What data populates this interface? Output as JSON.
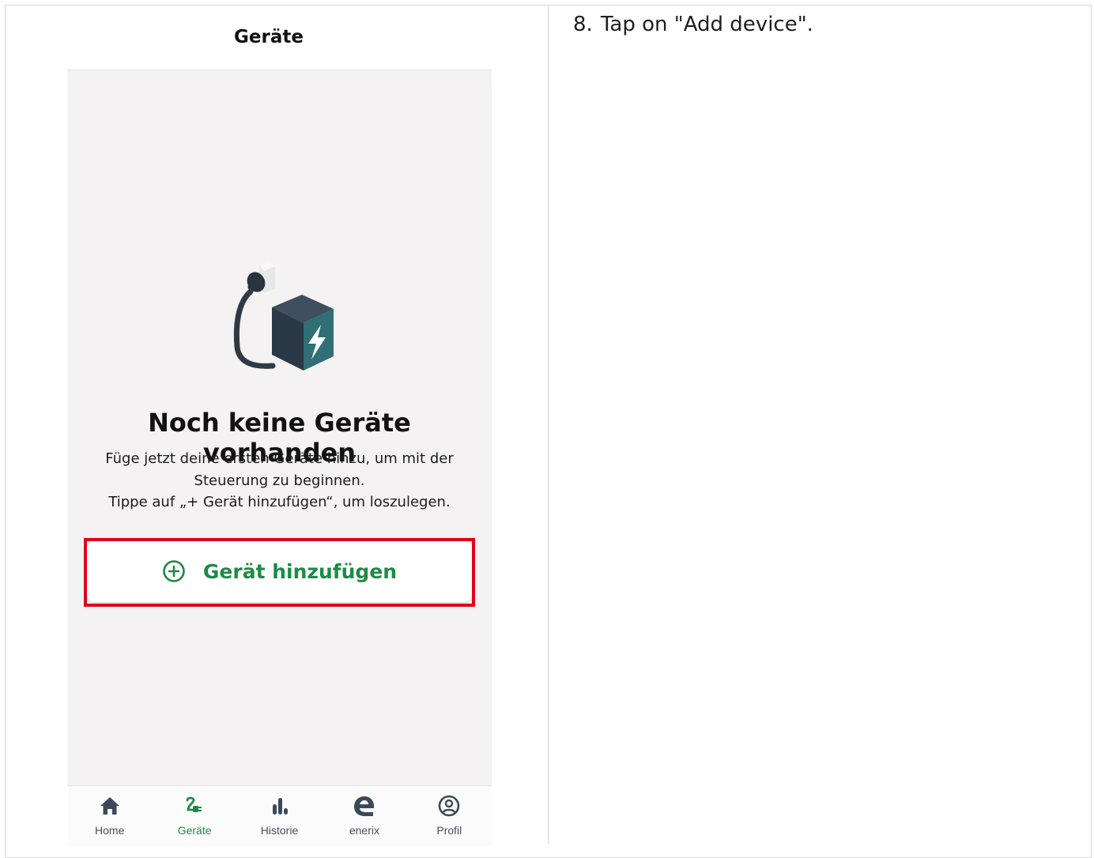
{
  "header": {
    "title": "Geräte"
  },
  "empty_state": {
    "title": "Noch keine Geräte vorhanden",
    "line1": "Füge jetzt deine ersten Geräte hinzu, um mit der",
    "line2": "Steuerung zu beginnen.",
    "line3": "Tippe auf „+ Gerät hinzufügen“, um loszulegen.",
    "illustration_icon": "plug-device-icon"
  },
  "add_button": {
    "label": "Gerät hinzufügen",
    "icon": "plus-circle-icon"
  },
  "tabbar": {
    "items": [
      {
        "label": "Home",
        "icon": "home-icon"
      },
      {
        "label": "Geräte",
        "icon": "plug-icon",
        "active": true
      },
      {
        "label": "Historie",
        "icon": "bar-chart-icon"
      },
      {
        "label": "enerix",
        "icon": "enerix-logo-icon"
      },
      {
        "label": "Profil",
        "icon": "profile-icon"
      }
    ]
  },
  "instructions": {
    "step_number": "8.",
    "step_text": "Tap on \"Add device\"."
  },
  "colors": {
    "accent": "#1e8a47",
    "highlight": "#e1001a",
    "icon_dark": "#3b4a5a",
    "device_teal": "#2f6f6f"
  }
}
